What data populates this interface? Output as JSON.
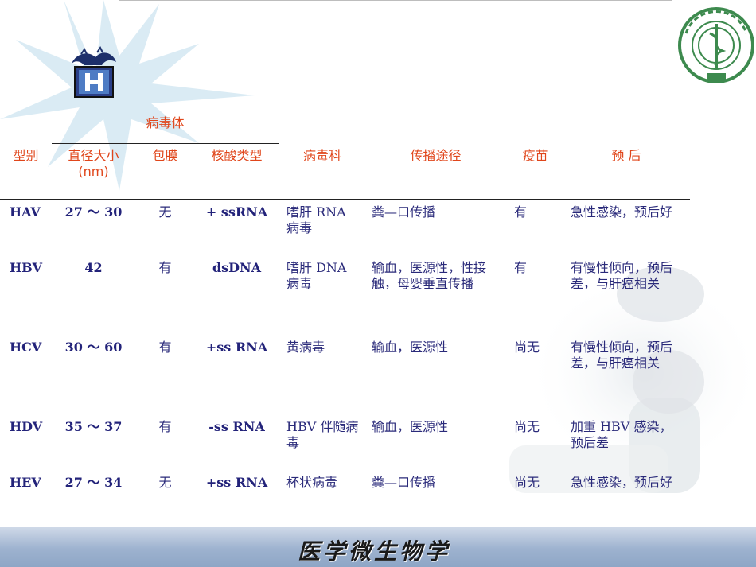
{
  "header": {
    "group_label": "病毒体",
    "columns": [
      "型别",
      "直径大小 (nm)",
      "包膜",
      "核酸类型",
      "病毒科",
      "传播途径",
      "疫苗",
      "预 后"
    ]
  },
  "rows": [
    {
      "type": "HAV",
      "size": "27 ～ 30",
      "envelope": "无",
      "nucleic": "+ ssRNA",
      "family": "嗜肝 RNA 病毒",
      "route": "粪—口传播",
      "vaccine": "有",
      "prognosis": "急性感染，预后好"
    },
    {
      "type": "HBV",
      "size": "42",
      "envelope": "有",
      "nucleic": "dsDNA",
      "family": "嗜肝 DNA 病毒",
      "route": "输血，医源性，性接触，母婴垂直传播",
      "vaccine": "有",
      "prognosis": "有慢性倾向，预后差，与肝癌相关"
    },
    {
      "type": "HCV",
      "size": "30 ～ 60",
      "envelope": "有",
      "nucleic": "+ss RNA",
      "family": "黄病毒",
      "route": "输血，医源性",
      "vaccine": "尚无",
      "prognosis": "有慢性倾向，预后差，与肝癌相关"
    },
    {
      "type": "HDV",
      "size": "35 ～ 37",
      "envelope": "有",
      "nucleic": "-ss RNA",
      "family": "HBV 伴随病毒",
      "route": "输血，医源性",
      "vaccine": "尚无",
      "prognosis": "加重 HBV 感染，预后差"
    },
    {
      "type": "HEV",
      "size": "27 ～ 34",
      "envelope": "无",
      "nucleic": "+ss RNA",
      "family": "杯状病毒",
      "route": "粪—口传播",
      "vaccine": "尚无",
      "prognosis": "急性感染，预后好"
    }
  ],
  "footer": {
    "title": "医学微生物学"
  },
  "colors": {
    "header_text": "#e0461b",
    "body_text": "#2a2a7a",
    "accent": "#7fb5d4"
  },
  "icons": [
    "dragon-book-emblem-icon",
    "university-seal-icon",
    "starburst-decoration-icon",
    "microscope-background-icon"
  ]
}
